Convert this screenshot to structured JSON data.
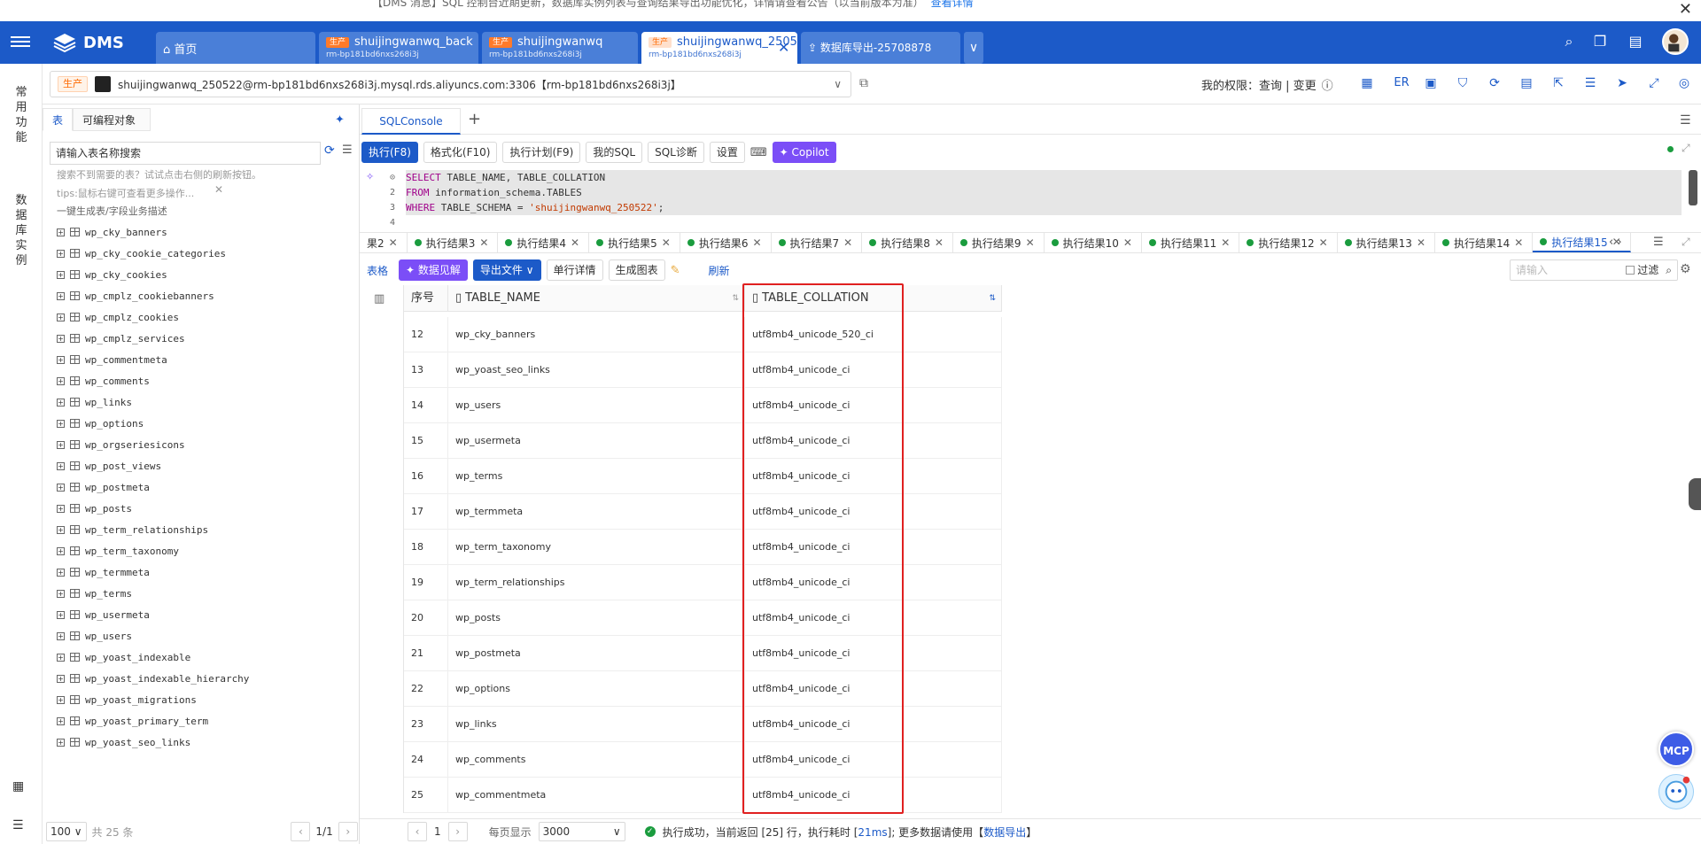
{
  "notice": {
    "text": "【DMS 消息】SQL 控制台近期更新，数据库实例列表与查询结果导出功能优化，详情请查看公告（以当前版本为准）",
    "link": "查看详情"
  },
  "header": {
    "logo": "DMS",
    "tabs": [
      {
        "label": "首页"
      },
      {
        "env": "生产",
        "title": "shuijingwanwq_back",
        "sub": "rm-bp181bd6nxs268i3j"
      },
      {
        "env": "生产",
        "title": "shuijingwanwq",
        "sub": "rm-bp181bd6nxs268i3j"
      },
      {
        "env": "生产",
        "title": "shuijingwanwq_2505",
        "sub": "rm-bp181bd6nxs268i3j"
      },
      {
        "label": "数据库导出-25708878"
      }
    ],
    "more": "∨"
  },
  "rail": {
    "common": "常用功能",
    "instances": "数据库实例"
  },
  "connection": {
    "env": "生产",
    "text": "shuijingwanwq_250522@rm-bp181bd6nxs268i3j.mysql.rds.aliyuncs.com:3306【rm-bp181bd6nxs268i3j】",
    "permission": "我的权限：查询 | 变更",
    "er": "ER"
  },
  "objects": {
    "tabs": [
      "表",
      "可编程对象"
    ],
    "search_placeholder": "请输入表名称搜索",
    "hint1": "搜索不到需要的表？试试点击右侧的刷新按钮。",
    "hint2": "tips:鼠标右键可查看更多操作...",
    "hint3": "一键生成表/字段业务描述",
    "tables": [
      "wp_cky_banners",
      "wp_cky_cookie_categories",
      "wp_cky_cookies",
      "wp_cmplz_cookiebanners",
      "wp_cmplz_cookies",
      "wp_cmplz_services",
      "wp_commentmeta",
      "wp_comments",
      "wp_links",
      "wp_options",
      "wp_orgseriesicons",
      "wp_post_views",
      "wp_postmeta",
      "wp_posts",
      "wp_term_relationships",
      "wp_term_taxonomy",
      "wp_termmeta",
      "wp_terms",
      "wp_usermeta",
      "wp_users",
      "wp_yoast_indexable",
      "wp_yoast_indexable_hierarchy",
      "wp_yoast_migrations",
      "wp_yoast_primary_term",
      "wp_yoast_seo_links"
    ],
    "page_size": "100",
    "total": "共 25 条",
    "page": "1/1"
  },
  "console": {
    "tab": "SQLConsole",
    "add": "+",
    "buttons": {
      "run": "执行(F8)",
      "format": "格式化(F10)",
      "plan": "执行计划(F9)",
      "mysql": "我的SQL",
      "diag": "SQL诊断",
      "settings": "设置",
      "copilot": "Copilot"
    },
    "code": {
      "l1a": "SELECT",
      "l1b": " TABLE_NAME, TABLE_COLLATION",
      "l2a": "FROM",
      "l2b": " information_schema.TABLES",
      "l3a": "WHERE",
      "l3b": " TABLE_SCHEMA = ",
      "l3c": "'shuijingwanwq_250522'",
      "l3d": ";"
    }
  },
  "result_tabs": [
    "果2",
    "执行结果3",
    "执行结果4",
    "执行结果5",
    "执行结果6",
    "执行结果7",
    "执行结果8",
    "执行结果9",
    "执行结果10",
    "执行结果11",
    "执行结果12",
    "执行结果13",
    "执行结果14",
    "执行结果15"
  ],
  "result_toolbar": {
    "table": "表格",
    "insight": "数据见解",
    "export": "导出文件",
    "detail": "单行详情",
    "chart": "生成图表",
    "refresh": "刷新",
    "filter_placeholder": "请输入",
    "filter": "过滤"
  },
  "grid": {
    "headers": {
      "seq": "序号",
      "name": "TABLE_NAME",
      "collation": "TABLE_COLLATION"
    },
    "rows": [
      {
        "seq": "12",
        "name": "wp_cky_banners",
        "collation": "utf8mb4_unicode_520_ci"
      },
      {
        "seq": "13",
        "name": "wp_yoast_seo_links",
        "collation": "utf8mb4_unicode_ci"
      },
      {
        "seq": "14",
        "name": "wp_users",
        "collation": "utf8mb4_unicode_ci"
      },
      {
        "seq": "15",
        "name": "wp_usermeta",
        "collation": "utf8mb4_unicode_ci"
      },
      {
        "seq": "16",
        "name": "wp_terms",
        "collation": "utf8mb4_unicode_ci"
      },
      {
        "seq": "17",
        "name": "wp_termmeta",
        "collation": "utf8mb4_unicode_ci"
      },
      {
        "seq": "18",
        "name": "wp_term_taxonomy",
        "collation": "utf8mb4_unicode_ci"
      },
      {
        "seq": "19",
        "name": "wp_term_relationships",
        "collation": "utf8mb4_unicode_ci"
      },
      {
        "seq": "20",
        "name": "wp_posts",
        "collation": "utf8mb4_unicode_ci"
      },
      {
        "seq": "21",
        "name": "wp_postmeta",
        "collation": "utf8mb4_unicode_ci"
      },
      {
        "seq": "22",
        "name": "wp_options",
        "collation": "utf8mb4_unicode_ci"
      },
      {
        "seq": "23",
        "name": "wp_links",
        "collation": "utf8mb4_unicode_ci"
      },
      {
        "seq": "24",
        "name": "wp_comments",
        "collation": "utf8mb4_unicode_ci"
      },
      {
        "seq": "25",
        "name": "wp_commentmeta",
        "collation": "utf8mb4_unicode_ci"
      }
    ]
  },
  "status": {
    "page": "1",
    "per_page_label": "每页显示",
    "per_page": "3000",
    "msg1": "执行成功，当前返回 [25] 行，执行耗时 [",
    "time": "21ms",
    "msg2": "]; 更多数据请使用【",
    "export_link": "数据导出",
    "msg3": "】"
  },
  "floating": {
    "mcp": "MCP"
  },
  "colors": {
    "header": "#1c5ac8",
    "prod": "#ff7a29",
    "success": "#1a9c3e",
    "highlight_box": "#e02020",
    "copilot": "#7b4ef7"
  }
}
